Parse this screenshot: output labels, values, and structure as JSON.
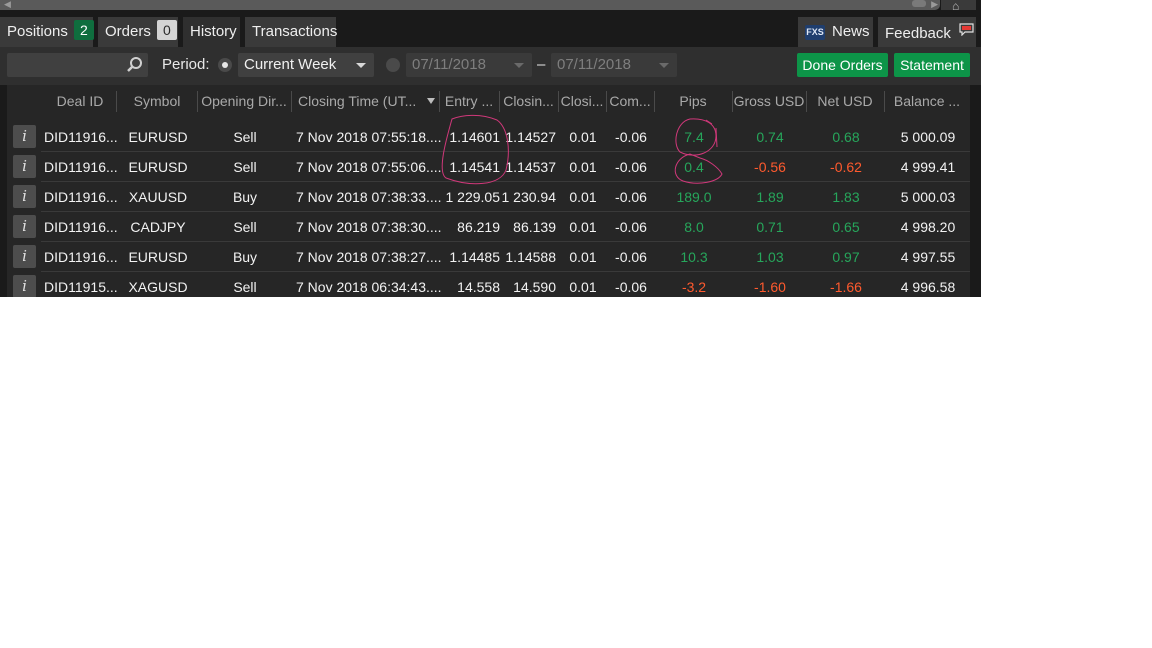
{
  "tabs": [
    {
      "label": "Positions",
      "badge": "2"
    },
    {
      "label": "Orders",
      "badge": "0"
    },
    {
      "label": "History"
    },
    {
      "label": "Transactions"
    }
  ],
  "right_tabs": {
    "news_logo": "FXS",
    "news_label": "News",
    "feedback_label": "Feedback"
  },
  "toolbar": {
    "search_value": "",
    "period_label": "Period:",
    "period_selected": "Current Week",
    "date_from": "07/11/2018",
    "date_separator": "–",
    "date_to": "07/11/2018",
    "done_orders_label": "Done Orders",
    "statement_label": "Statement"
  },
  "columns": [
    "Deal ID",
    "Symbol",
    "Opening Dir...",
    "Closing Time  (UT...",
    "Entry ...",
    "Closin...",
    "Closi...",
    "Com...",
    "Pips",
    "Gross USD",
    "Net USD",
    "Balance ..."
  ],
  "rows": [
    {
      "deal_id": "DID11916...",
      "symbol": "EURUSD",
      "direction": "Sell",
      "closing_time": "7 Nov 2018 07:55:18....",
      "entry": "1.14601",
      "closing": "1.14527",
      "volume": "0.01",
      "commission": "-0.06",
      "pips": "7.4",
      "gross": "0.74",
      "net": "0.68",
      "balance": "5 000.09"
    },
    {
      "deal_id": "DID11916...",
      "symbol": "EURUSD",
      "direction": "Sell",
      "closing_time": "7 Nov 2018 07:55:06....",
      "entry": "1.14541",
      "closing": "1.14537",
      "volume": "0.01",
      "commission": "-0.06",
      "pips": "0.4",
      "gross": "-0.56",
      "net": "-0.62",
      "balance": "4 999.41"
    },
    {
      "deal_id": "DID11916...",
      "symbol": "XAUUSD",
      "direction": "Buy",
      "closing_time": "7 Nov 2018 07:38:33....",
      "entry": "1 229.05",
      "closing": "1 230.94",
      "volume": "0.01",
      "commission": "-0.06",
      "pips": "189.0",
      "gross": "1.89",
      "net": "1.83",
      "balance": "5 000.03"
    },
    {
      "deal_id": "DID11916...",
      "symbol": "CADJPY",
      "direction": "Sell",
      "closing_time": "7 Nov 2018 07:38:30....",
      "entry": "86.219",
      "closing": "86.139",
      "volume": "0.01",
      "commission": "-0.06",
      "pips": "8.0",
      "gross": "0.71",
      "net": "0.65",
      "balance": "4 998.20"
    },
    {
      "deal_id": "DID11916...",
      "symbol": "EURUSD",
      "direction": "Buy",
      "closing_time": "7 Nov 2018 07:38:27....",
      "entry": "1.14485",
      "closing": "1.14588",
      "volume": "0.01",
      "commission": "-0.06",
      "pips": "10.3",
      "gross": "1.03",
      "net": "0.97",
      "balance": "4 997.55"
    },
    {
      "deal_id": "DID11915...",
      "symbol": "XAGUSD",
      "direction": "Sell",
      "closing_time": "7 Nov 2018 06:34:43....",
      "entry": "14.558",
      "closing": "14.590",
      "volume": "0.01",
      "commission": "-0.06",
      "pips": "-3.2",
      "gross": "-1.60",
      "net": "-1.66",
      "balance": "4 996.58"
    }
  ],
  "icons": {
    "info": "i"
  },
  "colors": {
    "profit": "#26a65b",
    "loss": "#ff5a2e",
    "accent_button": "#0d9448",
    "annotation": "#d0387a"
  }
}
